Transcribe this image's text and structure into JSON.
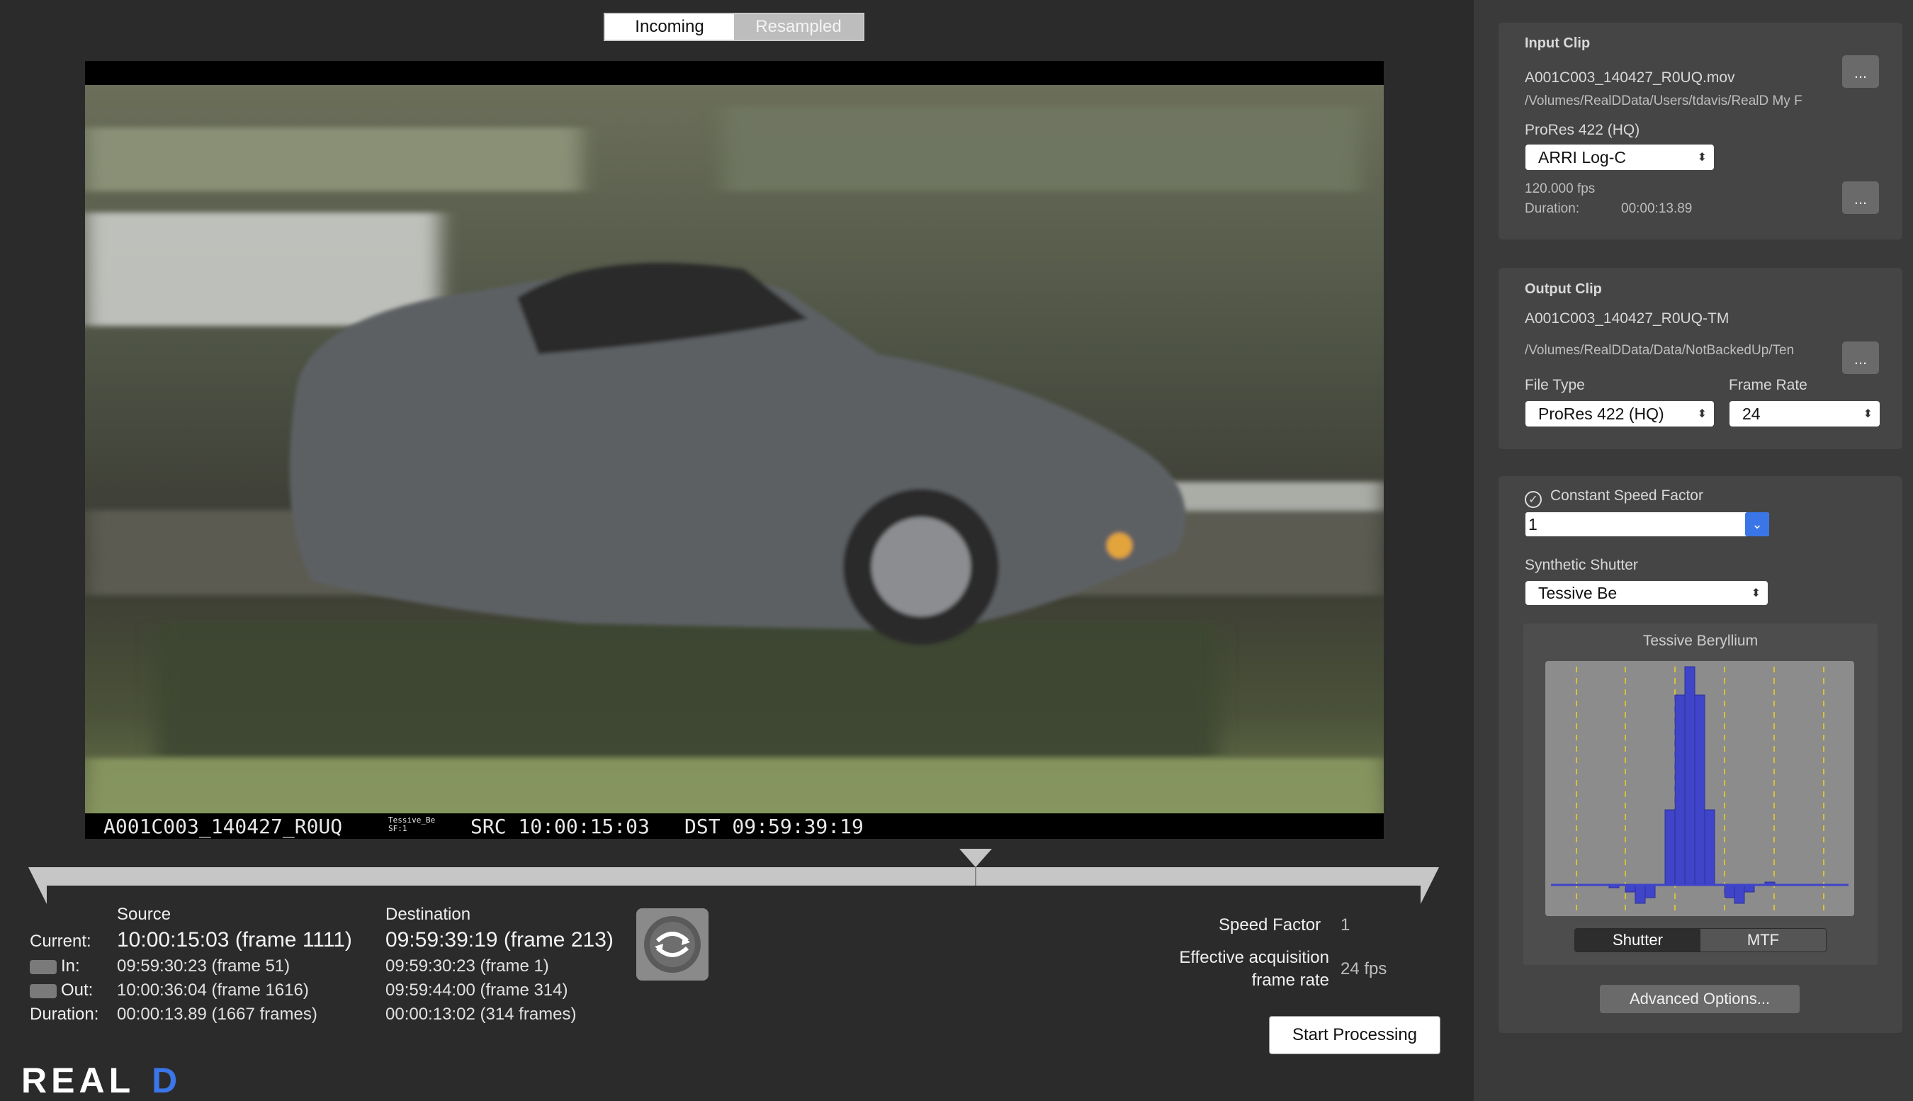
{
  "view_toggle": {
    "incoming": "Incoming",
    "resampled": "Resampled"
  },
  "overlay": {
    "clip": "A001C003_140427_R0UQ",
    "tiny1": "Tessive_Be",
    "tiny2": "SF:1",
    "src": "SRC 10:00:15:03",
    "dst": "DST 09:59:39:19"
  },
  "info": {
    "source_header": "Source",
    "destination_header": "Destination",
    "current_label": "Current:",
    "in_label": "In:",
    "out_label": "Out:",
    "duration_label": "Duration:",
    "source_current": "10:00:15:03 (frame 1111)",
    "source_in": "09:59:30:23 (frame 51)",
    "source_out": "10:00:36:04 (frame 1616)",
    "source_duration": "00:00:13.89 (1667 frames)",
    "dest_current": "09:59:39:19 (frame 213)",
    "dest_in": "09:59:30:23 (frame 1)",
    "dest_out": "09:59:44:00 (frame 314)",
    "dest_duration": "00:00:13:02 (314 frames)",
    "speed_factor_label": "Speed Factor",
    "speed_factor_value": "1",
    "eff_label_1": "Effective acquisition",
    "eff_label_2": "frame rate",
    "eff_value": "24 fps",
    "start_processing": "Start Processing"
  },
  "logo": {
    "real": "REAL",
    "d": "D"
  },
  "input_clip": {
    "title": "Input Clip",
    "filename": "A001C003_140427_R0UQ.mov",
    "path": "/Volumes/RealDData/Users/tdavis/RealD My F",
    "codec": "ProRes 422 (HQ)",
    "colorspace": "ARRI Log-C",
    "fps": "120.000 fps",
    "duration_label": "Duration:",
    "duration": "00:00:13.89",
    "more": "..."
  },
  "output_clip": {
    "title": "Output Clip",
    "filename": "A001C003_140427_R0UQ-TM",
    "path": "/Volumes/RealDData/Data/NotBackedUp/Ten",
    "file_type_label": "File Type",
    "file_type": "ProRes 422 (HQ)",
    "frame_rate_label": "Frame Rate",
    "frame_rate": "24",
    "more": "..."
  },
  "shutter": {
    "csf_label": "Constant Speed Factor",
    "csf_value": "1",
    "synthetic_label": "Synthetic Shutter",
    "synthetic_value": "Tessive Be",
    "graph_title": "Tessive Beryllium",
    "tab_shutter": "Shutter",
    "tab_mtf": "MTF",
    "advanced": "Advanced Options..."
  },
  "colors": {
    "accent_blue": "#3a76e8",
    "shutter_bar": "#3f44c8",
    "graph_bg": "#8c8c8c",
    "dash": "#d7c13a"
  }
}
